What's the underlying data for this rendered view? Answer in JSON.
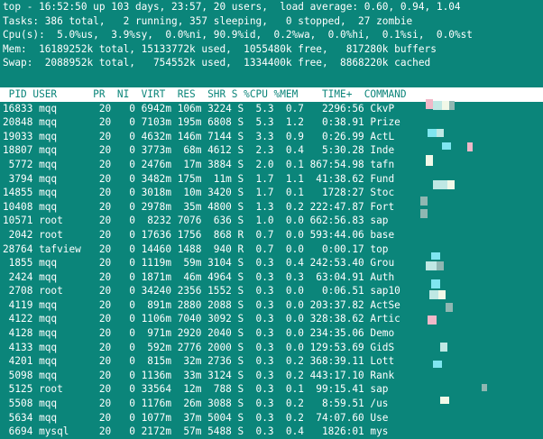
{
  "summary": {
    "line1": "top - 16:52:50 up 103 days, 23:57, 20 users,  load average: 0.60, 0.94, 1.04",
    "line2": "Tasks: 386 total,   2 running, 357 sleeping,   0 stopped,  27 zombie",
    "line3": "Cpu(s):  5.0%us,  3.9%sy,  0.0%ni, 90.9%id,  0.2%wa,  0.0%hi,  0.1%si,  0.0%st",
    "line4": "Mem:  16189252k total, 15133772k used,  1055480k free,   817280k buffers",
    "line5": "Swap:  2088952k total,   754552k used,  1334400k free,  8868220k cached"
  },
  "header": " PID USER      PR  NI  VIRT  RES  SHR S %CPU %MEM    TIME+  COMMAND",
  "rows": [
    "16833 mqq       20   0 6942m 106m 3224 S  5.3  0.7   2296:56 CkvP",
    "20848 mqq       20   0 7103m 195m 6808 S  5.3  1.2   0:38.91 Prize",
    "19033 mqq       20   0 4632m 146m 7144 S  3.3  0.9   0:26.99 ActL",
    "18807 mqq       20   0 3773m  68m 4612 S  2.3  0.4   5:30.28 Inde",
    " 5772 mqq       20   0 2476m  17m 3884 S  2.0  0.1 867:54.98 tafn",
    " 3794 mqq       20   0 3482m 175m  11m S  1.7  1.1  41:38.62 Fund",
    "14855 mqq       20   0 3018m  10m 3420 S  1.7  0.1   1728:27 Stoc",
    "10408 mqq       20   0 2978m  35m 4800 S  1.3  0.2 222:47.87 Fort",
    "10571 root      20   0  8232 7076  636 S  1.0  0.0 662:56.83 sap",
    " 2042 root      20   0 17636 1756  868 R  0.7  0.0 593:44.06 base",
    "28764 tafview   20   0 14460 1488  940 R  0.7  0.0   0:00.17 top",
    " 1855 mqq       20   0 1119m  59m 3104 S  0.3  0.4 242:53.40 Grou",
    " 2424 mqq       20   0 1871m  46m 4964 S  0.3  0.3  63:04.91 Auth",
    " 2708 root      20   0 34240 2356 1552 S  0.3  0.0   0:06.51 sap10",
    " 4119 mqq       20   0  891m 2880 2088 S  0.3  0.0 203:37.82 ActSe",
    " 4122 mqq       20   0 1106m 7040 3092 S  0.3  0.0 328:38.62 Artic",
    " 4128 mqq       20   0  971m 2920 2040 S  0.3  0.0 234:35.06 Demo",
    " 4133 mqq       20   0  592m 2776 2000 S  0.3  0.0 129:53.69 GidS",
    " 4201 mqq       20   0  815m  32m 2736 S  0.3  0.2 368:39.11 Lott",
    " 5098 mqq       20   0 1136m  33m 3124 S  0.3  0.2 443:17.10 Rank",
    " 5125 root      20   0 33564  12m  788 S  0.3  0.1  99:15.41 sap",
    " 5508 mqq       20   0 1176m  26m 3088 S  0.3  0.2   8:59.51 /us",
    " 5634 mqq       20   0 1077m  37m 5004 S  0.3  0.2  74:07.60 Use",
    " 6694 mysql     20   0 2172m  57m 5488 S  0.3  0.4   1826:01 mys"
  ],
  "colors": {
    "background": "#0b857a",
    "foreground": "#ffffff",
    "pixel_light": "#bfe8e4",
    "pixel_pale": "#f1f8e8",
    "pixel_cyan": "#7fe6f0",
    "pixel_pink": "#f0b8c8",
    "pixel_grey": "#8fb7b2"
  }
}
